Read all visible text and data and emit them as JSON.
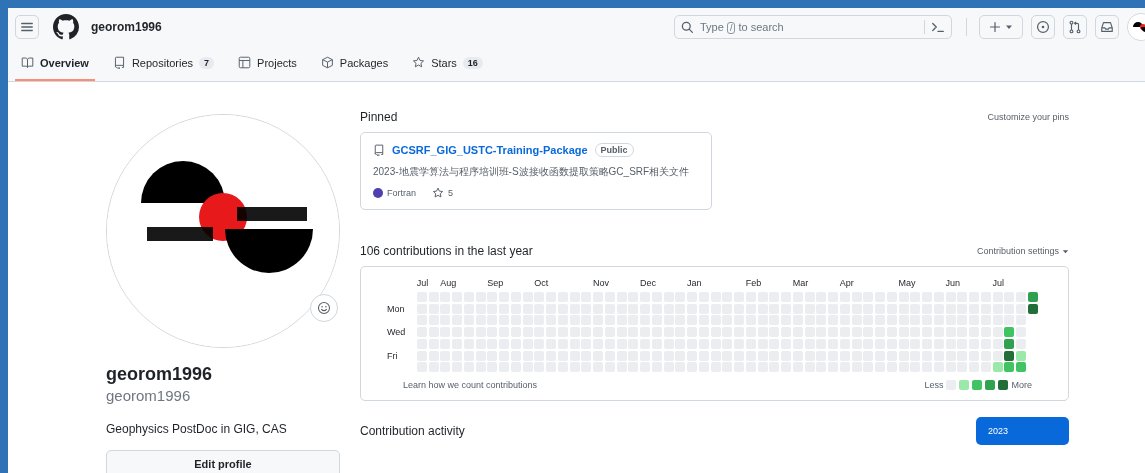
{
  "header": {
    "username": "georom1996",
    "search": {
      "before": "Type",
      "key": "/",
      "after": "to search"
    }
  },
  "tabs": [
    {
      "label": "Overview",
      "kind": "book",
      "selected": true
    },
    {
      "label": "Repositories",
      "kind": "repo",
      "count": "7",
      "selected": false
    },
    {
      "label": "Projects",
      "kind": "table",
      "selected": false
    },
    {
      "label": "Packages",
      "kind": "package",
      "selected": false
    },
    {
      "label": "Stars",
      "kind": "star",
      "count": "16",
      "selected": false
    }
  ],
  "profile": {
    "name": "georom1996",
    "login": "georom1996",
    "bio": "Geophysics PostDoc in GIG, CAS",
    "edit_button": "Edit profile"
  },
  "pinned": {
    "title": "Pinned",
    "customize": "Customize your pins",
    "repos": [
      {
        "name": "GCSRF_GIG_USTC-Training-Package",
        "visibility": "Public",
        "description": "2023-地震学算法与程序培训班-S波接收函数提取策略GC_SRF相关文件",
        "language": "Fortran",
        "color": "#4d41b1",
        "stars": "5"
      }
    ]
  },
  "contributions": {
    "title": "106 contributions in the last year",
    "settings": "Contribution settings",
    "learn": "Learn how we count contributions",
    "day_labels": [
      {
        "text": "Mon"
      },
      {
        "text": "Wed"
      },
      {
        "text": "Fri"
      }
    ],
    "legend": {
      "less": "Less",
      "more": "More",
      "swatches": [
        {
          "color": "#ebedf0"
        },
        {
          "color": "#9be9a8"
        },
        {
          "color": "#40c463"
        },
        {
          "color": "#30a14e"
        },
        {
          "color": "#216e39"
        }
      ]
    },
    "weeks": [
      {
        "month": "Jul",
        "days": [
          {
            "color": "#ebedf0"
          },
          {
            "color": "#ebedf0"
          },
          {
            "color": "#ebedf0"
          },
          {
            "color": "#ebedf0"
          },
          {
            "color": "#ebedf0"
          },
          {
            "color": "#ebedf0"
          },
          {
            "color": "#ebedf0"
          }
        ]
      },
      {
        "days": [
          {
            "color": "#ebedf0"
          },
          {
            "color": "#ebedf0"
          },
          {
            "color": "#ebedf0"
          },
          {
            "color": "#ebedf0"
          },
          {
            "color": "#ebedf0"
          },
          {
            "color": "#ebedf0"
          },
          {
            "color": "#ebedf0"
          }
        ]
      },
      {
        "month": "Aug",
        "days": [
          {
            "color": "#ebedf0"
          },
          {
            "color": "#ebedf0"
          },
          {
            "color": "#ebedf0"
          },
          {
            "color": "#ebedf0"
          },
          {
            "color": "#ebedf0"
          },
          {
            "color": "#ebedf0"
          },
          {
            "color": "#ebedf0"
          }
        ]
      },
      {
        "days": [
          {
            "color": "#ebedf0"
          },
          {
            "color": "#ebedf0"
          },
          {
            "color": "#ebedf0"
          },
          {
            "color": "#ebedf0"
          },
          {
            "color": "#ebedf0"
          },
          {
            "color": "#ebedf0"
          },
          {
            "color": "#ebedf0"
          }
        ]
      },
      {
        "days": [
          {
            "color": "#ebedf0"
          },
          {
            "color": "#ebedf0"
          },
          {
            "color": "#ebedf0"
          },
          {
            "color": "#ebedf0"
          },
          {
            "color": "#ebedf0"
          },
          {
            "color": "#ebedf0"
          },
          {
            "color": "#ebedf0"
          }
        ]
      },
      {
        "days": [
          {
            "color": "#ebedf0"
          },
          {
            "color": "#ebedf0"
          },
          {
            "color": "#ebedf0"
          },
          {
            "color": "#ebedf0"
          },
          {
            "color": "#ebedf0"
          },
          {
            "color": "#ebedf0"
          },
          {
            "color": "#ebedf0"
          }
        ]
      },
      {
        "month": "Sep",
        "days": [
          {
            "color": "#ebedf0"
          },
          {
            "color": "#ebedf0"
          },
          {
            "color": "#ebedf0"
          },
          {
            "color": "#ebedf0"
          },
          {
            "color": "#ebedf0"
          },
          {
            "color": "#ebedf0"
          },
          {
            "color": "#ebedf0"
          }
        ]
      },
      {
        "days": [
          {
            "color": "#ebedf0"
          },
          {
            "color": "#ebedf0"
          },
          {
            "color": "#ebedf0"
          },
          {
            "color": "#ebedf0"
          },
          {
            "color": "#ebedf0"
          },
          {
            "color": "#ebedf0"
          },
          {
            "color": "#ebedf0"
          }
        ]
      },
      {
        "days": [
          {
            "color": "#ebedf0"
          },
          {
            "color": "#ebedf0"
          },
          {
            "color": "#ebedf0"
          },
          {
            "color": "#ebedf0"
          },
          {
            "color": "#ebedf0"
          },
          {
            "color": "#ebedf0"
          },
          {
            "color": "#ebedf0"
          }
        ]
      },
      {
        "days": [
          {
            "color": "#ebedf0"
          },
          {
            "color": "#ebedf0"
          },
          {
            "color": "#ebedf0"
          },
          {
            "color": "#ebedf0"
          },
          {
            "color": "#ebedf0"
          },
          {
            "color": "#ebedf0"
          },
          {
            "color": "#ebedf0"
          }
        ]
      },
      {
        "month": "Oct",
        "days": [
          {
            "color": "#ebedf0"
          },
          {
            "color": "#ebedf0"
          },
          {
            "color": "#ebedf0"
          },
          {
            "color": "#ebedf0"
          },
          {
            "color": "#ebedf0"
          },
          {
            "color": "#ebedf0"
          },
          {
            "color": "#ebedf0"
          }
        ]
      },
      {
        "days": [
          {
            "color": "#ebedf0"
          },
          {
            "color": "#ebedf0"
          },
          {
            "color": "#ebedf0"
          },
          {
            "color": "#ebedf0"
          },
          {
            "color": "#ebedf0"
          },
          {
            "color": "#ebedf0"
          },
          {
            "color": "#ebedf0"
          }
        ]
      },
      {
        "days": [
          {
            "color": "#ebedf0"
          },
          {
            "color": "#ebedf0"
          },
          {
            "color": "#ebedf0"
          },
          {
            "color": "#ebedf0"
          },
          {
            "color": "#ebedf0"
          },
          {
            "color": "#ebedf0"
          },
          {
            "color": "#ebedf0"
          }
        ]
      },
      {
        "days": [
          {
            "color": "#ebedf0"
          },
          {
            "color": "#ebedf0"
          },
          {
            "color": "#ebedf0"
          },
          {
            "color": "#ebedf0"
          },
          {
            "color": "#ebedf0"
          },
          {
            "color": "#ebedf0"
          },
          {
            "color": "#ebedf0"
          }
        ]
      },
      {
        "days": [
          {
            "color": "#ebedf0"
          },
          {
            "color": "#ebedf0"
          },
          {
            "color": "#ebedf0"
          },
          {
            "color": "#ebedf0"
          },
          {
            "color": "#ebedf0"
          },
          {
            "color": "#ebedf0"
          },
          {
            "color": "#ebedf0"
          }
        ]
      },
      {
        "month": "Nov",
        "days": [
          {
            "color": "#ebedf0"
          },
          {
            "color": "#ebedf0"
          },
          {
            "color": "#ebedf0"
          },
          {
            "color": "#ebedf0"
          },
          {
            "color": "#ebedf0"
          },
          {
            "color": "#ebedf0"
          },
          {
            "color": "#ebedf0"
          }
        ]
      },
      {
        "days": [
          {
            "color": "#ebedf0"
          },
          {
            "color": "#ebedf0"
          },
          {
            "color": "#ebedf0"
          },
          {
            "color": "#ebedf0"
          },
          {
            "color": "#ebedf0"
          },
          {
            "color": "#ebedf0"
          },
          {
            "color": "#ebedf0"
          }
        ]
      },
      {
        "days": [
          {
            "color": "#ebedf0"
          },
          {
            "color": "#ebedf0"
          },
          {
            "color": "#ebedf0"
          },
          {
            "color": "#ebedf0"
          },
          {
            "color": "#ebedf0"
          },
          {
            "color": "#ebedf0"
          },
          {
            "color": "#ebedf0"
          }
        ]
      },
      {
        "days": [
          {
            "color": "#ebedf0"
          },
          {
            "color": "#ebedf0"
          },
          {
            "color": "#ebedf0"
          },
          {
            "color": "#ebedf0"
          },
          {
            "color": "#ebedf0"
          },
          {
            "color": "#ebedf0"
          },
          {
            "color": "#ebedf0"
          }
        ]
      },
      {
        "month": "Dec",
        "days": [
          {
            "color": "#ebedf0"
          },
          {
            "color": "#ebedf0"
          },
          {
            "color": "#ebedf0"
          },
          {
            "color": "#ebedf0"
          },
          {
            "color": "#ebedf0"
          },
          {
            "color": "#ebedf0"
          },
          {
            "color": "#ebedf0"
          }
        ]
      },
      {
        "days": [
          {
            "color": "#ebedf0"
          },
          {
            "color": "#ebedf0"
          },
          {
            "color": "#ebedf0"
          },
          {
            "color": "#ebedf0"
          },
          {
            "color": "#ebedf0"
          },
          {
            "color": "#ebedf0"
          },
          {
            "color": "#ebedf0"
          }
        ]
      },
      {
        "days": [
          {
            "color": "#ebedf0"
          },
          {
            "color": "#ebedf0"
          },
          {
            "color": "#ebedf0"
          },
          {
            "color": "#ebedf0"
          },
          {
            "color": "#ebedf0"
          },
          {
            "color": "#ebedf0"
          },
          {
            "color": "#ebedf0"
          }
        ]
      },
      {
        "days": [
          {
            "color": "#ebedf0"
          },
          {
            "color": "#ebedf0"
          },
          {
            "color": "#ebedf0"
          },
          {
            "color": "#ebedf0"
          },
          {
            "color": "#ebedf0"
          },
          {
            "color": "#ebedf0"
          },
          {
            "color": "#ebedf0"
          }
        ]
      },
      {
        "month": "Jan",
        "days": [
          {
            "color": "#ebedf0"
          },
          {
            "color": "#ebedf0"
          },
          {
            "color": "#ebedf0"
          },
          {
            "color": "#ebedf0"
          },
          {
            "color": "#ebedf0"
          },
          {
            "color": "#ebedf0"
          },
          {
            "color": "#ebedf0"
          }
        ]
      },
      {
        "days": [
          {
            "color": "#ebedf0"
          },
          {
            "color": "#ebedf0"
          },
          {
            "color": "#ebedf0"
          },
          {
            "color": "#ebedf0"
          },
          {
            "color": "#ebedf0"
          },
          {
            "color": "#ebedf0"
          },
          {
            "color": "#ebedf0"
          }
        ]
      },
      {
        "days": [
          {
            "color": "#ebedf0"
          },
          {
            "color": "#ebedf0"
          },
          {
            "color": "#ebedf0"
          },
          {
            "color": "#ebedf0"
          },
          {
            "color": "#ebedf0"
          },
          {
            "color": "#ebedf0"
          },
          {
            "color": "#ebedf0"
          }
        ]
      },
      {
        "days": [
          {
            "color": "#ebedf0"
          },
          {
            "color": "#ebedf0"
          },
          {
            "color": "#ebedf0"
          },
          {
            "color": "#ebedf0"
          },
          {
            "color": "#ebedf0"
          },
          {
            "color": "#ebedf0"
          },
          {
            "color": "#ebedf0"
          }
        ]
      },
      {
        "days": [
          {
            "color": "#ebedf0"
          },
          {
            "color": "#ebedf0"
          },
          {
            "color": "#ebedf0"
          },
          {
            "color": "#ebedf0"
          },
          {
            "color": "#ebedf0"
          },
          {
            "color": "#ebedf0"
          },
          {
            "color": "#ebedf0"
          }
        ]
      },
      {
        "month": "Feb",
        "days": [
          {
            "color": "#ebedf0"
          },
          {
            "color": "#ebedf0"
          },
          {
            "color": "#ebedf0"
          },
          {
            "color": "#ebedf0"
          },
          {
            "color": "#ebedf0"
          },
          {
            "color": "#ebedf0"
          },
          {
            "color": "#ebedf0"
          }
        ]
      },
      {
        "days": [
          {
            "color": "#ebedf0"
          },
          {
            "color": "#ebedf0"
          },
          {
            "color": "#ebedf0"
          },
          {
            "color": "#ebedf0"
          },
          {
            "color": "#ebedf0"
          },
          {
            "color": "#ebedf0"
          },
          {
            "color": "#ebedf0"
          }
        ]
      },
      {
        "days": [
          {
            "color": "#ebedf0"
          },
          {
            "color": "#ebedf0"
          },
          {
            "color": "#ebedf0"
          },
          {
            "color": "#ebedf0"
          },
          {
            "color": "#ebedf0"
          },
          {
            "color": "#ebedf0"
          },
          {
            "color": "#ebedf0"
          }
        ]
      },
      {
        "days": [
          {
            "color": "#ebedf0"
          },
          {
            "color": "#ebedf0"
          },
          {
            "color": "#ebedf0"
          },
          {
            "color": "#ebedf0"
          },
          {
            "color": "#ebedf0"
          },
          {
            "color": "#ebedf0"
          },
          {
            "color": "#ebedf0"
          }
        ]
      },
      {
        "month": "Mar",
        "days": [
          {
            "color": "#ebedf0"
          },
          {
            "color": "#ebedf0"
          },
          {
            "color": "#ebedf0"
          },
          {
            "color": "#ebedf0"
          },
          {
            "color": "#ebedf0"
          },
          {
            "color": "#ebedf0"
          },
          {
            "color": "#ebedf0"
          }
        ]
      },
      {
        "days": [
          {
            "color": "#ebedf0"
          },
          {
            "color": "#ebedf0"
          },
          {
            "color": "#ebedf0"
          },
          {
            "color": "#ebedf0"
          },
          {
            "color": "#ebedf0"
          },
          {
            "color": "#ebedf0"
          },
          {
            "color": "#ebedf0"
          }
        ]
      },
      {
        "days": [
          {
            "color": "#ebedf0"
          },
          {
            "color": "#ebedf0"
          },
          {
            "color": "#ebedf0"
          },
          {
            "color": "#ebedf0"
          },
          {
            "color": "#ebedf0"
          },
          {
            "color": "#ebedf0"
          },
          {
            "color": "#ebedf0"
          }
        ]
      },
      {
        "days": [
          {
            "color": "#ebedf0"
          },
          {
            "color": "#ebedf0"
          },
          {
            "color": "#ebedf0"
          },
          {
            "color": "#ebedf0"
          },
          {
            "color": "#ebedf0"
          },
          {
            "color": "#ebedf0"
          },
          {
            "color": "#ebedf0"
          }
        ]
      },
      {
        "month": "Apr",
        "days": [
          {
            "color": "#ebedf0"
          },
          {
            "color": "#ebedf0"
          },
          {
            "color": "#ebedf0"
          },
          {
            "color": "#ebedf0"
          },
          {
            "color": "#ebedf0"
          },
          {
            "color": "#ebedf0"
          },
          {
            "color": "#ebedf0"
          }
        ]
      },
      {
        "days": [
          {
            "color": "#ebedf0"
          },
          {
            "color": "#ebedf0"
          },
          {
            "color": "#ebedf0"
          },
          {
            "color": "#ebedf0"
          },
          {
            "color": "#ebedf0"
          },
          {
            "color": "#ebedf0"
          },
          {
            "color": "#ebedf0"
          }
        ]
      },
      {
        "days": [
          {
            "color": "#ebedf0"
          },
          {
            "color": "#ebedf0"
          },
          {
            "color": "#ebedf0"
          },
          {
            "color": "#ebedf0"
          },
          {
            "color": "#ebedf0"
          },
          {
            "color": "#ebedf0"
          },
          {
            "color": "#ebedf0"
          }
        ]
      },
      {
        "days": [
          {
            "color": "#ebedf0"
          },
          {
            "color": "#ebedf0"
          },
          {
            "color": "#ebedf0"
          },
          {
            "color": "#ebedf0"
          },
          {
            "color": "#ebedf0"
          },
          {
            "color": "#ebedf0"
          },
          {
            "color": "#ebedf0"
          }
        ]
      },
      {
        "days": [
          {
            "color": "#ebedf0"
          },
          {
            "color": "#ebedf0"
          },
          {
            "color": "#ebedf0"
          },
          {
            "color": "#ebedf0"
          },
          {
            "color": "#ebedf0"
          },
          {
            "color": "#ebedf0"
          },
          {
            "color": "#ebedf0"
          }
        ]
      },
      {
        "month": "May",
        "days": [
          {
            "color": "#ebedf0"
          },
          {
            "color": "#ebedf0"
          },
          {
            "color": "#ebedf0"
          },
          {
            "color": "#ebedf0"
          },
          {
            "color": "#ebedf0"
          },
          {
            "color": "#ebedf0"
          },
          {
            "color": "#ebedf0"
          }
        ]
      },
      {
        "days": [
          {
            "color": "#ebedf0"
          },
          {
            "color": "#ebedf0"
          },
          {
            "color": "#ebedf0"
          },
          {
            "color": "#ebedf0"
          },
          {
            "color": "#ebedf0"
          },
          {
            "color": "#ebedf0"
          },
          {
            "color": "#ebedf0"
          }
        ]
      },
      {
        "days": [
          {
            "color": "#ebedf0"
          },
          {
            "color": "#ebedf0"
          },
          {
            "color": "#ebedf0"
          },
          {
            "color": "#ebedf0"
          },
          {
            "color": "#ebedf0"
          },
          {
            "color": "#ebedf0"
          },
          {
            "color": "#ebedf0"
          }
        ]
      },
      {
        "days": [
          {
            "color": "#ebedf0"
          },
          {
            "color": "#ebedf0"
          },
          {
            "color": "#ebedf0"
          },
          {
            "color": "#ebedf0"
          },
          {
            "color": "#ebedf0"
          },
          {
            "color": "#ebedf0"
          },
          {
            "color": "#ebedf0"
          }
        ]
      },
      {
        "month": "Jun",
        "days": [
          {
            "color": "#ebedf0"
          },
          {
            "color": "#ebedf0"
          },
          {
            "color": "#ebedf0"
          },
          {
            "color": "#ebedf0"
          },
          {
            "color": "#ebedf0"
          },
          {
            "color": "#ebedf0"
          },
          {
            "color": "#ebedf0"
          }
        ]
      },
      {
        "days": [
          {
            "color": "#ebedf0"
          },
          {
            "color": "#ebedf0"
          },
          {
            "color": "#ebedf0"
          },
          {
            "color": "#ebedf0"
          },
          {
            "color": "#ebedf0"
          },
          {
            "color": "#ebedf0"
          },
          {
            "color": "#ebedf0"
          }
        ]
      },
      {
        "days": [
          {
            "color": "#ebedf0"
          },
          {
            "color": "#ebedf0"
          },
          {
            "color": "#ebedf0"
          },
          {
            "color": "#ebedf0"
          },
          {
            "color": "#ebedf0"
          },
          {
            "color": "#ebedf0"
          },
          {
            "color": "#ebedf0"
          }
        ]
      },
      {
        "days": [
          {
            "color": "#ebedf0"
          },
          {
            "color": "#ebedf0"
          },
          {
            "color": "#ebedf0"
          },
          {
            "color": "#ebedf0"
          },
          {
            "color": "#ebedf0"
          },
          {
            "color": "#ebedf0"
          },
          {
            "color": "#ebedf0"
          }
        ]
      },
      {
        "month": "Jul",
        "days": [
          {
            "color": "#ebedf0"
          },
          {
            "color": "#ebedf0"
          },
          {
            "color": "#ebedf0"
          },
          {
            "color": "#ebedf0"
          },
          {
            "color": "#ebedf0"
          },
          {
            "color": "#ebedf0"
          },
          {
            "color": "#9be9a8"
          }
        ]
      },
      {
        "days": [
          {
            "color": "#ebedf0"
          },
          {
            "color": "#ebedf0"
          },
          {
            "color": "#ebedf0"
          },
          {
            "color": "#40c463"
          },
          {
            "color": "#30a14e"
          },
          {
            "color": "#216e39"
          },
          {
            "color": "#40c463"
          }
        ]
      },
      {
        "days": [
          {
            "color": "#ebedf0"
          },
          {
            "color": "#ebedf0"
          },
          {
            "color": "#ebedf0"
          },
          {
            "color": "#ebedf0"
          },
          {
            "color": "#ebedf0"
          },
          {
            "color": "#9be9a8"
          },
          {
            "color": "#40c463"
          }
        ]
      },
      {
        "days": [
          {
            "color": "#30a14e"
          },
          {
            "color": "#216e39"
          }
        ]
      }
    ]
  },
  "activity": {
    "title": "Contribution activity",
    "years": [
      {
        "label": "2023",
        "selected": true
      }
    ]
  }
}
